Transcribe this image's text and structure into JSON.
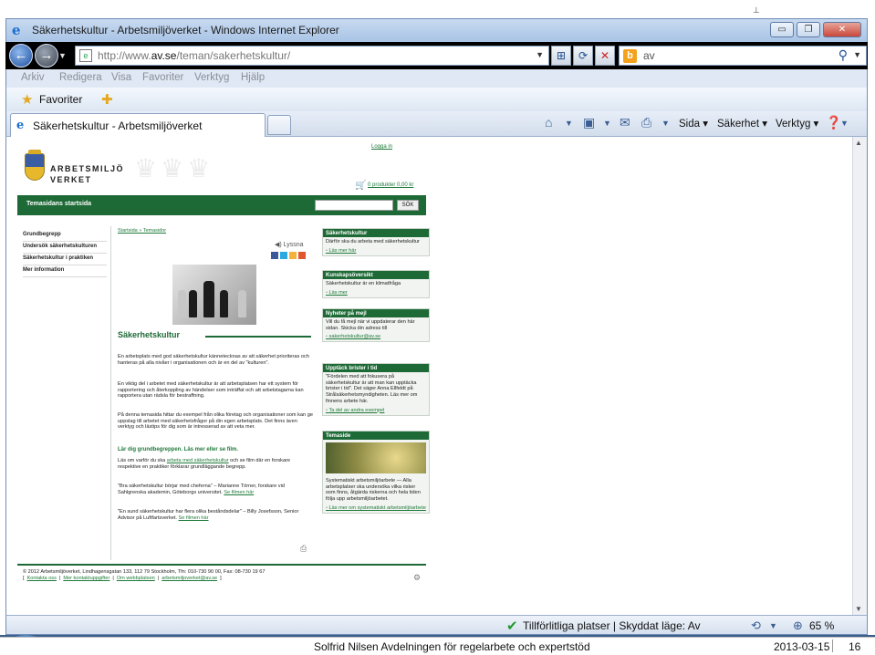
{
  "window": {
    "title": "Säkerhetskultur - Arbetsmiljöverket - Windows Internet Explorer",
    "min_label": "▭",
    "max_label": "❐",
    "close_label": "✕"
  },
  "navbar": {
    "url_prefix": "http://www.",
    "url_host": "av.se",
    "url_path": "/teman/sakerhetskultur/",
    "search_value": "av"
  },
  "menubar": {
    "items": [
      "Arkiv",
      "Redigera",
      "Visa",
      "Favoriter",
      "Verktyg",
      "Hjälp"
    ]
  },
  "favorites": {
    "label": "Favoriter"
  },
  "tabs": {
    "active_title": "Säkerhetskultur - Arbetsmiljöverket",
    "commands": [
      "Sida",
      "Säkerhet",
      "Verktyg"
    ]
  },
  "site": {
    "logout": "Logga in",
    "brand_line1": "ARBETSMILJÖ",
    "brand_line2": "VERKET",
    "cart": "0 produkter 0,00 kr",
    "green_title": "Temasidans startsida",
    "search_button": "SÖK",
    "leftnav": [
      "Grundbegrepp",
      "Undersök säkerhetskulturen",
      "Säkerhetskultur i praktiken",
      "Mer information"
    ],
    "crumbs": "Startsida » Temasidor",
    "lyssna": "◀) Lyssna",
    "heading": "Säkerhetskultur",
    "para1": "En arbetsplats med god säkerhetskultur kännetecknas av att säkerhet prioriteras och hanteras på alla nivåer i organisationen och är en del av \"kulturen\".",
    "para2": "En viktig del i arbetet med säkerhetskultur är att arbetsplatsen har ett system för rapportering och återkoppling av händelser som inträffat och att arbetstagarna kan rapportera utan rädsla för bestraffning.",
    "para3": "På denna temasida hittar du exempel från olika företag och organisationer som kan ge uppslag till arbetet med säkerhetsfrågor på din egen arbetsplats. Det finns även verktyg och lästips för dig som är intresserad av att veta mer.",
    "para4": "Lär dig grundbegreppen. Läs mer eller se film.",
    "para5a": "Läs om varför du ska ",
    "para5link": "arbeta med säkerhetskultur",
    "para5b": " och se film där en forskare respektive en praktiker förklarar grundläggande begrepp.",
    "para6a": "\"Bra säkerhetskultur börjar med cheferna\" – Marianne Törner, forskare vid Sahlgrenska akademin, Göteborgs universitet. ",
    "para6link": "Se filmen här",
    "para7a": "\"En sund säkerhetskultur har flera olika beståndsdelar\" – Billy Josefsson, Senior Advisor på Luftfartsverket. ",
    "para7link": "Se filmen här",
    "print_icon": "⎙",
    "boxes": [
      {
        "head": "Säkerhetskultur",
        "text": "Därför ska du arbeta med säkerhetskultur",
        "links": [
          "Läs mer här"
        ]
      },
      {
        "head": "Kunskapsöversikt",
        "text": "Säkerhetskultur är en klimatfråga",
        "links": [
          "Läs mer"
        ]
      },
      {
        "head": "Nyheter på mejl",
        "text": "Vill du få mejl när vi uppdaterar den här sidan. Skicka din adress till",
        "links": [
          "sakerhetskultur@av.se"
        ]
      },
      {
        "head": "Upptäck brister i tid",
        "text": "\"Fördelen med att fokusera på säkerhetskultur är att man kan upptäcka brister i tid\". Det säger Anna Ellfeldt på Strålsäkerhetsmyndigheten. Läs mer om finnens arbete här.",
        "links": [
          "Ta del av andra exempel"
        ]
      },
      {
        "head": "Temaside",
        "text": "Systematiskt arbetsmiljöarbete — Alla arbetsplatser ska undersöka vilka risker som finns, åtgärda riskerna och hela tiden följa upp arbetsmiljöarbetet.",
        "links": [
          "Läs mer om systematiskt arbetsmiljöarbete"
        ]
      }
    ],
    "footer_line1": "© 2012 Arbetsmiljöverket, Lindhagensgatan 133, 112 79 Stockholm, Tfn: 010-730 90 00, Fax: 08-730 19 67",
    "footer_links": [
      "Kontakta oss",
      "Mer kontaktuppgifter",
      "Om webbplatsen",
      "arbetsmiljoverket@av.se"
    ]
  },
  "status": {
    "zone": "Tillförlitliga platser | Skyddat läge: Av",
    "zoom": "65 %"
  },
  "overlay": {
    "footer_text": "Solfrid Nilsen Avdelningen för regelarbete och expertstöd",
    "date": "2013-03-15",
    "page": "16"
  }
}
